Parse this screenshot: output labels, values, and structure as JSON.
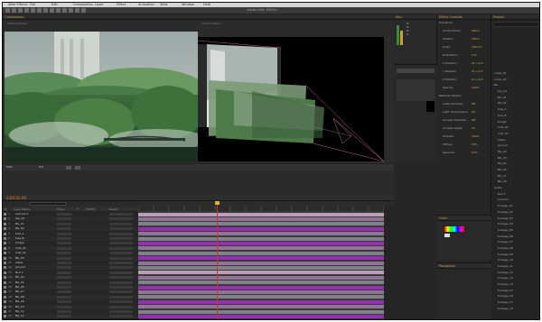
{
  "app": {
    "window_title": "Adobe After Effects",
    "menu": [
      "After Effects",
      "File",
      "Edit",
      "Composition",
      "Layer",
      "Effect",
      "Animation",
      "View",
      "Window",
      "Help"
    ]
  },
  "composition_panel": {
    "tab_label": "Composition",
    "left_view_label": "Active Camera",
    "right_view_label": "Custom View 1",
    "zoom": "50%",
    "resolution": "Full"
  },
  "timeline": {
    "timecode": "0:00:02:08",
    "columns": [
      "#",
      "Layer Name",
      "Mode",
      "T",
      "TrkMat",
      "Parent"
    ],
    "layers": [
      {
        "num": "1",
        "name": "Camera 1"
      },
      {
        "num": "2",
        "name": "sky_01"
      },
      {
        "num": "3",
        "name": "BG_01"
      },
      {
        "num": "4",
        "name": "BG_02"
      },
      {
        "num": "5",
        "name": "tree_A"
      },
      {
        "num": "6",
        "name": "tree_B"
      },
      {
        "num": "7",
        "name": "bridge"
      },
      {
        "num": "8",
        "name": "mist_01"
      },
      {
        "num": "9",
        "name": "mist_02"
      },
      {
        "num": "10",
        "name": "BG_03"
      },
      {
        "num": "11",
        "name": "water"
      },
      {
        "num": "12",
        "name": "ground"
      },
      {
        "num": "13",
        "name": "Null 1"
      },
      {
        "num": "14",
        "name": "BG_04"
      },
      {
        "num": "15",
        "name": "BG_05"
      },
      {
        "num": "16",
        "name": "BG_06"
      },
      {
        "num": "17",
        "name": "BG_07"
      },
      {
        "num": "18",
        "name": "BG_08"
      },
      {
        "num": "19",
        "name": "BG_09"
      },
      {
        "num": "20",
        "name": "BG_10"
      },
      {
        "num": "21",
        "name": "BG_11"
      },
      {
        "num": "22",
        "name": "BG_12"
      }
    ]
  },
  "info_panel": {
    "tab_label": "Info",
    "values": [
      "R:",
      "G:",
      "B:",
      "A:"
    ]
  },
  "effects_panel": {
    "tab_label": "Effect Controls",
    "properties": [
      {
        "name": "Transform",
        "value": ""
      },
      {
        "name": "Anchor Point",
        "value": "960.0"
      },
      {
        "name": "Position",
        "value": "540.0"
      },
      {
        "name": "Scale",
        "value": "100.0%"
      },
      {
        "name": "Orientation",
        "value": "0.0°"
      },
      {
        "name": "X Rotation",
        "value": "0x +0.0°"
      },
      {
        "name": "Y Rotation",
        "value": "0x +0.0°"
      },
      {
        "name": "Z Rotation",
        "value": "0x +0.0°"
      },
      {
        "name": "Opacity",
        "value": "100%"
      },
      {
        "name": "Material Options",
        "value": ""
      },
      {
        "name": "Casts Shadows",
        "value": "Off"
      },
      {
        "name": "Light Transmission",
        "value": "0%"
      },
      {
        "name": "Accepts Shadows",
        "value": "Off"
      },
      {
        "name": "Accepts Lights",
        "value": "On"
      },
      {
        "name": "Ambient",
        "value": "100%"
      },
      {
        "name": "Diffuse",
        "value": "50%"
      },
      {
        "name": "Specular",
        "value": "50%"
      }
    ]
  },
  "project_panel": {
    "tab_label": "Project",
    "items": [
      "comp_01",
      "comp_02",
      "BG",
      "sky_01",
      "BG_01",
      "BG_02",
      "tree_A",
      "tree_B",
      "bridge",
      "mist_01",
      "mist_02",
      "water",
      "ground",
      "BG_03",
      "BG_04",
      "BG_05",
      "BG_06",
      "BG_07",
      "BG_08",
      "Solids",
      "Null 1",
      "Camera",
      "footage_01",
      "footage_02",
      "footage_03",
      "footage_04",
      "footage_05",
      "footage_06",
      "footage_07",
      "footage_08",
      "footage_09",
      "footage_10",
      "footage_11",
      "footage_12",
      "footage_13",
      "footage_14",
      "footage_15",
      "footage_16",
      "footage_17",
      "footage_18"
    ]
  },
  "color_panel": {
    "tab_label": "Color"
  },
  "paragraph_panel": {
    "tab_label": "Paragraph"
  },
  "colors": {
    "bg": "#1e1e1e",
    "panel": "#2b2b2b",
    "accent_orange": "#d9a840",
    "bar_purple": "#9a7aa0",
    "bar_violet": "#a030c0",
    "bar_gray": "#8a8a94",
    "playhead": "#d03030"
  }
}
